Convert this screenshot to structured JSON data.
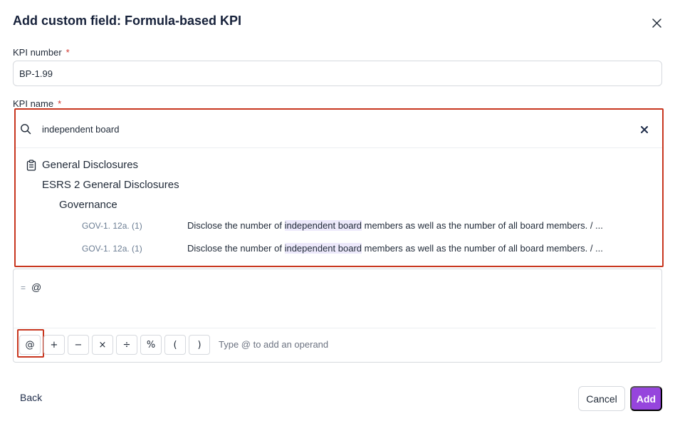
{
  "dialog": {
    "title": "Add custom field: Formula-based KPI"
  },
  "kpi_number": {
    "label": "KPI number",
    "required_mark": "*",
    "value": "BP-1.99"
  },
  "kpi_name": {
    "label": "KPI name",
    "required_mark": "*"
  },
  "search": {
    "query": "independent board",
    "results": {
      "category": "General Disclosures",
      "standard": "ESRS 2 General Disclosures",
      "section": "Governance",
      "rows": [
        {
          "code": "GOV-1. 12a. (1)",
          "desc_before": "Disclose the number of ",
          "desc_match": "independent board",
          "desc_after": " members as well as the number of all board members. / ..."
        },
        {
          "code": "GOV-1. 12a. (1)",
          "desc_before": "Disclose the number of ",
          "desc_match": "independent board",
          "desc_after": " members as well as the number of all board members. / ..."
        }
      ]
    }
  },
  "formula": {
    "prefix": "=",
    "value": "@",
    "operators": {
      "at": "@",
      "plus": "+",
      "minus": "−",
      "multiply": "×",
      "divide": "÷",
      "percent": "%",
      "open_paren": "(",
      "close_paren": ")"
    },
    "hint": "Type @ to add an operand"
  },
  "footer": {
    "back_label": "Back",
    "cancel_label": "Cancel",
    "add_label": "Add"
  },
  "colors": {
    "accent": "#9645dd",
    "highlight_outline": "#c8361f",
    "match_highlight": "#ede9fb"
  }
}
